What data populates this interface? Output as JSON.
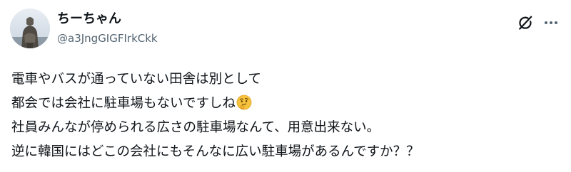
{
  "author": {
    "display_name": "ちーちゃん",
    "handle": "@a3JngGIGFIrkCkk"
  },
  "post": {
    "lines": [
      "電車やバスが通っていない田舎は別として",
      "都会では会社に駐車場もないですしね",
      "社員みんなが停められる広さの駐車場なんて、用意出来ない。",
      "逆に韓国にはどこの会社にもそんなに広い駐車場があるんですか？？"
    ],
    "emoji": "thinking-face"
  },
  "icons": {
    "grok": "grok-icon",
    "more": "more-options-icon"
  },
  "colors": {
    "text": "#0f1419",
    "secondary_text": "#536471",
    "background": "#ffffff"
  }
}
